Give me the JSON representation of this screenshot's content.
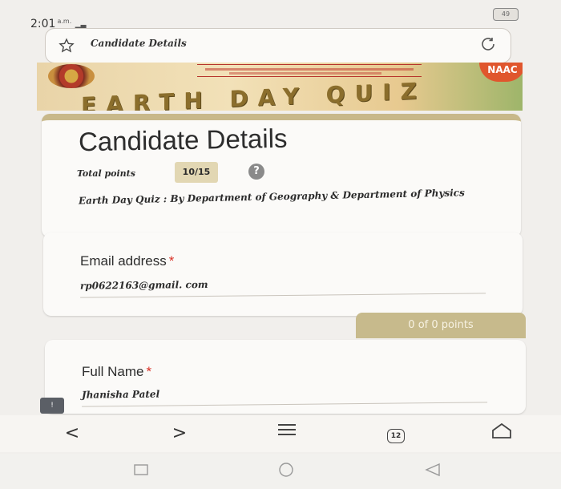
{
  "status_bar": {
    "time": "2:01",
    "time_suffix": "a.m.",
    "battery": "49"
  },
  "url_bar": {
    "title": "Candidate Details",
    "star_icon": "star-outline-icon",
    "reload_icon": "reload-icon"
  },
  "banner": {
    "title": "EARTH DAY QUIZ",
    "badge": "NAAC"
  },
  "form": {
    "title": "Candidate Details",
    "total_points_label": "Total points",
    "total_points_value": "10/15",
    "help_symbol": "?",
    "description": "Earth Day Quiz : By Department of Geography & Department of Physics"
  },
  "questions": [
    {
      "label": "Email address",
      "required_mark": "*",
      "answer": "rp0622163@gmail. com"
    },
    {
      "label": "Full Name",
      "required_mark": "*",
      "answer": "Jhanisha Patel"
    }
  ],
  "section_points": "0 of 0 points",
  "browser_nav": {
    "back": "<",
    "forward": ">",
    "tabs_count": "12"
  },
  "colors": {
    "accent": "#c8b88a",
    "required": "#d93025",
    "banner_title": "#8b6e2c"
  }
}
